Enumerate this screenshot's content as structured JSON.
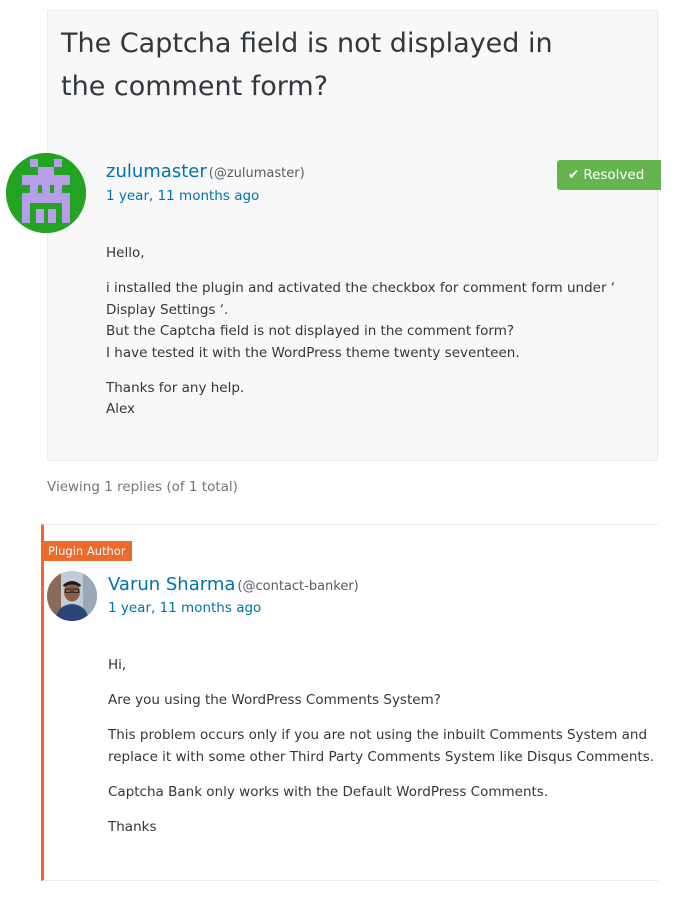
{
  "topic": {
    "title": "The Captcha field is not displayed in the comment form?",
    "author": {
      "name": "zulumaster",
      "handle": "(@zulumaster)",
      "date": "1 year, 11 months ago"
    },
    "status": {
      "icon": "checkmark-icon",
      "label": "Resolved",
      "color": "#64b450"
    },
    "body": [
      "Hello,",
      "i installed the plugin and activated the checkbox for comment form under ‘ Display Settings ‘.\nBut the Captcha field is not displayed in the comment form?\nI have tested it with the WordPress theme twenty seventeen.",
      "Thanks for any help.\nAlex"
    ]
  },
  "viewing_text": "Viewing 1 replies (of 1 total)",
  "reply": {
    "badge": "Plugin Author",
    "badge_color": "#ea6b2b",
    "author": {
      "name": "Varun Sharma",
      "handle": "(@contact-banker)",
      "date": "1 year, 11 months ago"
    },
    "body": [
      "Hi,",
      "Are you using the WordPress Comments System?",
      "This problem occurs only if you are not using the inbuilt Comments System and replace it with some other Third Party Comments System like Disqus Comments.",
      "Captcha Bank only works with the Default WordPress Comments.",
      "Thanks"
    ]
  },
  "colors": {
    "link": "#0073aa",
    "text": "#32373c",
    "muted": "#757575"
  }
}
